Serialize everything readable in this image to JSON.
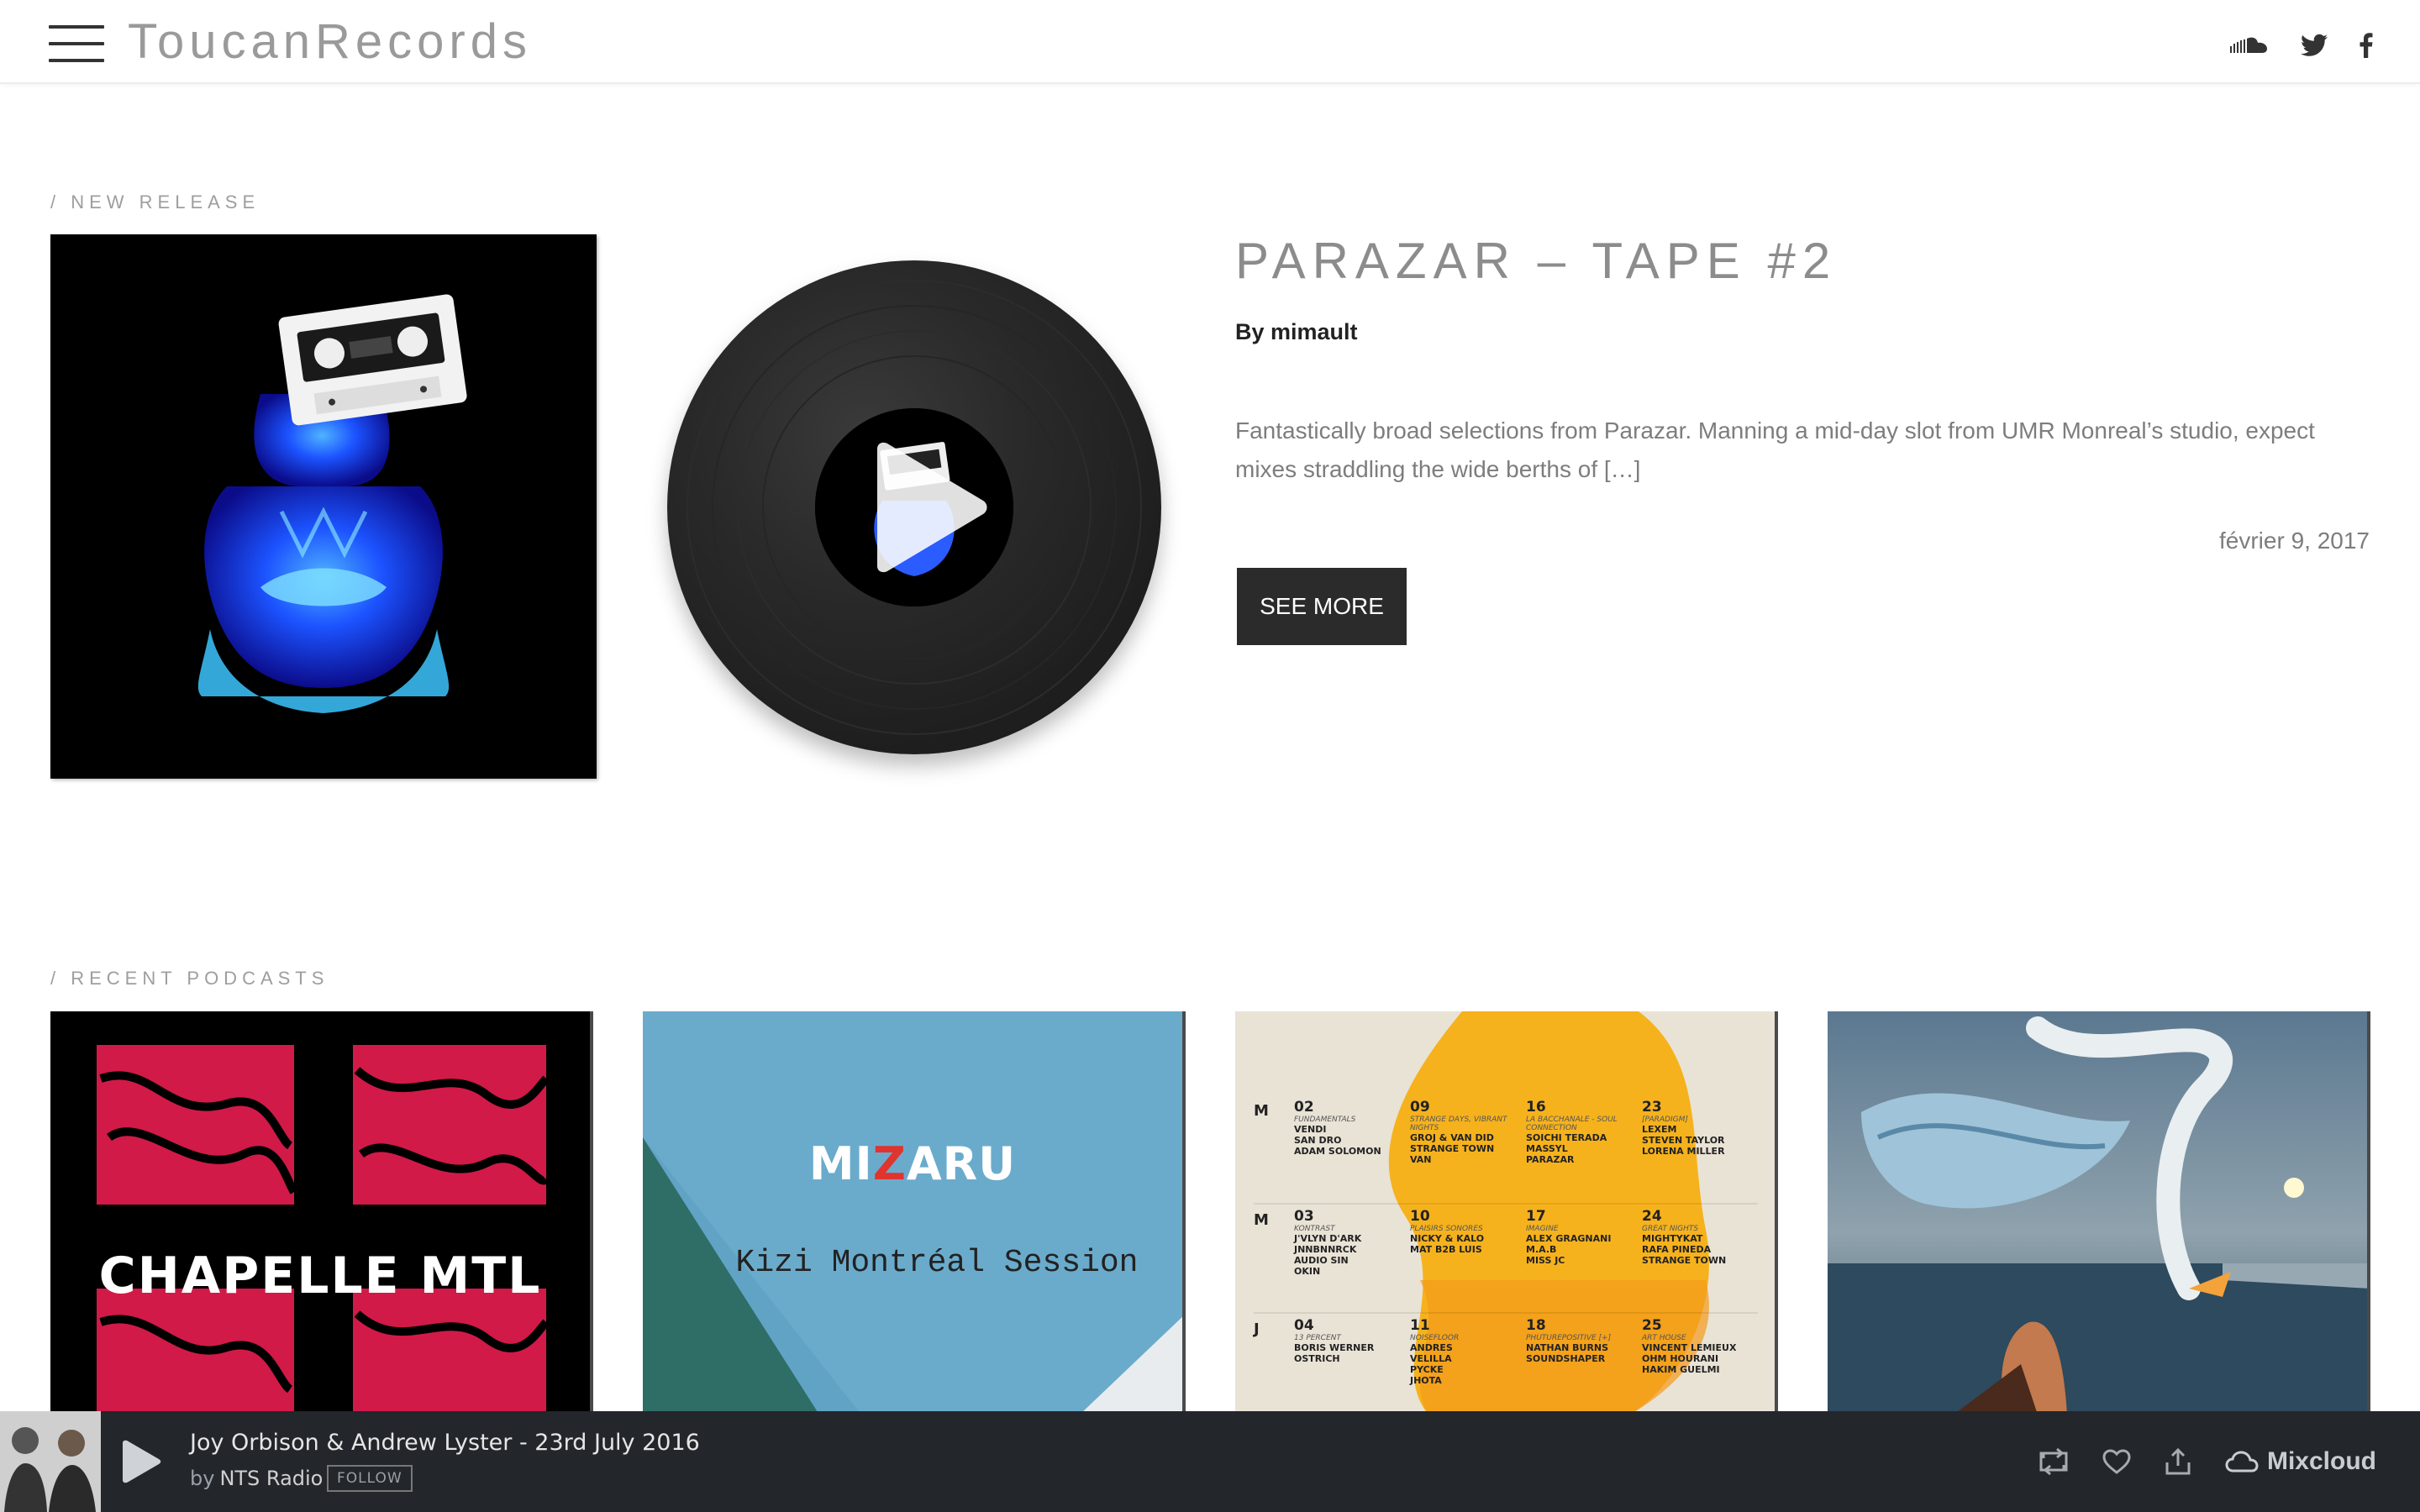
{
  "header": {
    "logo": "ToucanRecords",
    "social": [
      "soundcloud-icon",
      "twitter-icon",
      "facebook-icon"
    ]
  },
  "new_release": {
    "section_label": "/ NEW RELEASE",
    "title": "PARAZAR – TAPE #2",
    "by": "By mimault",
    "description": "Fantastically broad selections from Parazar. Manning a mid-day slot from UMR Monreal’s studio, expect mixes straddling the wide berths of […]",
    "date": "février 9, 2017",
    "see_more": "SEE MORE"
  },
  "recent_podcasts": {
    "section_label": "/ RECENT PODCASTS",
    "items": [
      {
        "cover_text": "CHAPELLE MTL"
      },
      {
        "logo_left": "MI",
        "logo_z": "Z",
        "logo_right": "ARU",
        "subtitle": "Kizi Montréal Session"
      },
      {
        "schedule": [
          {
            "day": "M",
            "cols": [
              {
                "num": "02",
                "tag": "FUNDAMENTALS",
                "names": "VENDI\nSAN DRO\nADAM SOLOMON"
              },
              {
                "num": "09",
                "tag": "STRANGE DAYS, VIBRANT NIGHTS",
                "names": "GROJ & VAN DID\nSTRANGE TOWN\nVAN"
              },
              {
                "num": "16",
                "tag": "LA BACCHANALE - SOUL CONNECTION",
                "names": "SOICHI TERADA\nMASSYL\nPARAZAR"
              },
              {
                "num": "23",
                "tag": "[PARADIGM]",
                "names": "LEXEM\nSTEVEN TAYLOR\nLORENA MILLER"
              }
            ]
          },
          {
            "day": "M",
            "cols": [
              {
                "num": "03",
                "tag": "KONTRAST",
                "names": "J'VLYN D'ARK\nJNNBNNRCK\nAUDIO SIN\nOKIN"
              },
              {
                "num": "10",
                "tag": "PLAISIRS SONORES",
                "names": "NICKY & KALO\nMAT B2B LUIS"
              },
              {
                "num": "17",
                "tag": "IMAGINE",
                "names": "ALEX GRAGNANI\nM.A.B\nMISS JC"
              },
              {
                "num": "24",
                "tag": "GREAT NIGHTS",
                "names": "MIGHTYKAT\nRAFA PINEDA\nSTRANGE TOWN"
              }
            ]
          },
          {
            "day": "J",
            "cols": [
              {
                "num": "04",
                "tag": "13 PERCENT",
                "names": "BORIS WERNER\nOSTRICH"
              },
              {
                "num": "11",
                "tag": "NOISEFLOOR",
                "names": "ANDRES\nVELILLA\nPYCKE\nJHOTA"
              },
              {
                "num": "18",
                "tag": "PHUTUREPOSITIVE [+]",
                "names": "NATHAN BURNS\nSOUNDSHAPER"
              },
              {
                "num": "25",
                "tag": "ART HOUSE",
                "names": "VINCENT LEMIEUX\nOHM HOURANI\nHAKIM GUELMI"
              }
            ]
          }
        ]
      },
      {
        "artwork": "swan-painting"
      }
    ]
  },
  "player": {
    "track_title": "Joy Orbison & Andrew Lyster - 23rd July 2016",
    "by_label": "by",
    "artist": "NTS Radio",
    "follow": "FOLLOW",
    "brand": "Mixcloud",
    "actions": [
      "repost-icon",
      "heart-icon",
      "share-icon",
      "mixcloud-icon"
    ]
  },
  "colors": {
    "player_bg": "#23262b",
    "button_bg": "#2b2b2b",
    "logo_gray": "#9a9a9a",
    "accent_red": "#e0342e"
  }
}
